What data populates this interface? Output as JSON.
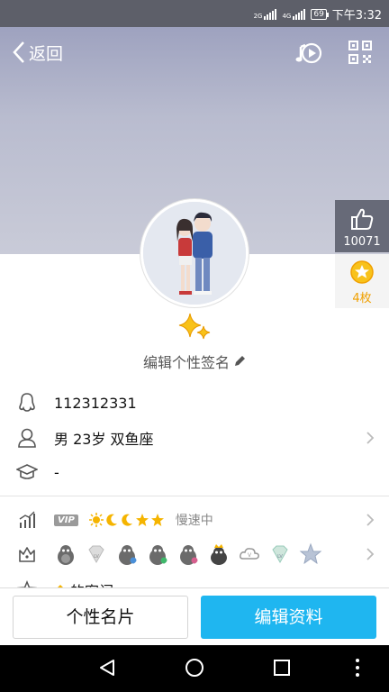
{
  "status_bar": {
    "network_top": "2G",
    "network_left": "4G",
    "network_bottom": "2G",
    "battery": "69",
    "time": "下午3:32"
  },
  "header": {
    "back_label": "返回",
    "icons": [
      "music-note-icon",
      "qr-code-icon"
    ]
  },
  "side_actions": {
    "likes": "10071",
    "stars": "4枚"
  },
  "profile": {
    "signature_placeholder": "编辑个性签名",
    "qq_number": "112312331",
    "basic_info": "男  23岁  双鱼座",
    "education": "-",
    "vip_badge": "VIP",
    "speed_status": "慢速中",
    "partial_row_text": "的密闪"
  },
  "buttons": {
    "card": "个性名片",
    "edit": "编辑资料"
  },
  "colors": {
    "accent": "#1fb6f0",
    "cover": "#b9bccf",
    "star": "#f0a000"
  }
}
